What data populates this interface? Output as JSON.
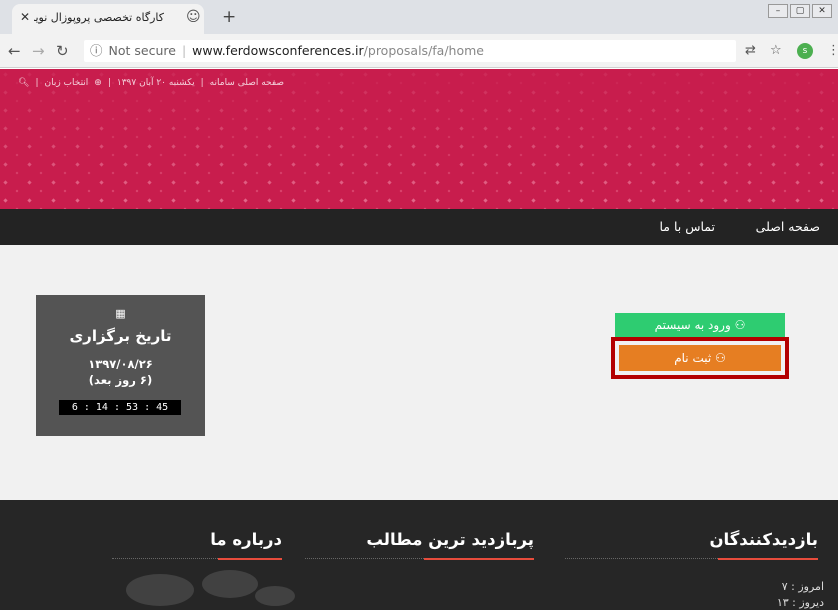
{
  "browser": {
    "tab_title": "کارگاه تخصصی پروپوزال نویسی",
    "url_info": "ⓘ",
    "url_security": "Not secure",
    "url_host": "www.ferdowsconferences.ir",
    "url_path": "/proposals/fa/home",
    "profile_initial": "s"
  },
  "topbar": {
    "home_link": "صفحه اصلی سامانه",
    "date": "یکشنبه ۲۰ آبان ۱۳۹۷",
    "language": "انتخاب زبان"
  },
  "nav": {
    "home": "صفحه اصلی",
    "contact": "تماس با ما"
  },
  "event": {
    "title": "تاریخ برگزاری",
    "date": "۱۳۹۷/۰۸/۲۶",
    "days_left": "(۶ روز بعد)",
    "countdown": "6 : 14 : 53 : 45"
  },
  "actions": {
    "login": "ورود به سیستم",
    "register": "ثبت نام"
  },
  "footer": {
    "visitors_title": "بازدیدکنندگان",
    "popular_title": "پربازدید ترین مطالب",
    "about_title": "درباره ما",
    "today": "امروز : ۷",
    "yesterday": "دیروز : ۱۳"
  },
  "colors": {
    "hero": "#c81d4d",
    "login": "#2ecc71",
    "register": "#e67e22",
    "highlight_frame": "#b30000",
    "accent_underline": "#e74c3c"
  }
}
